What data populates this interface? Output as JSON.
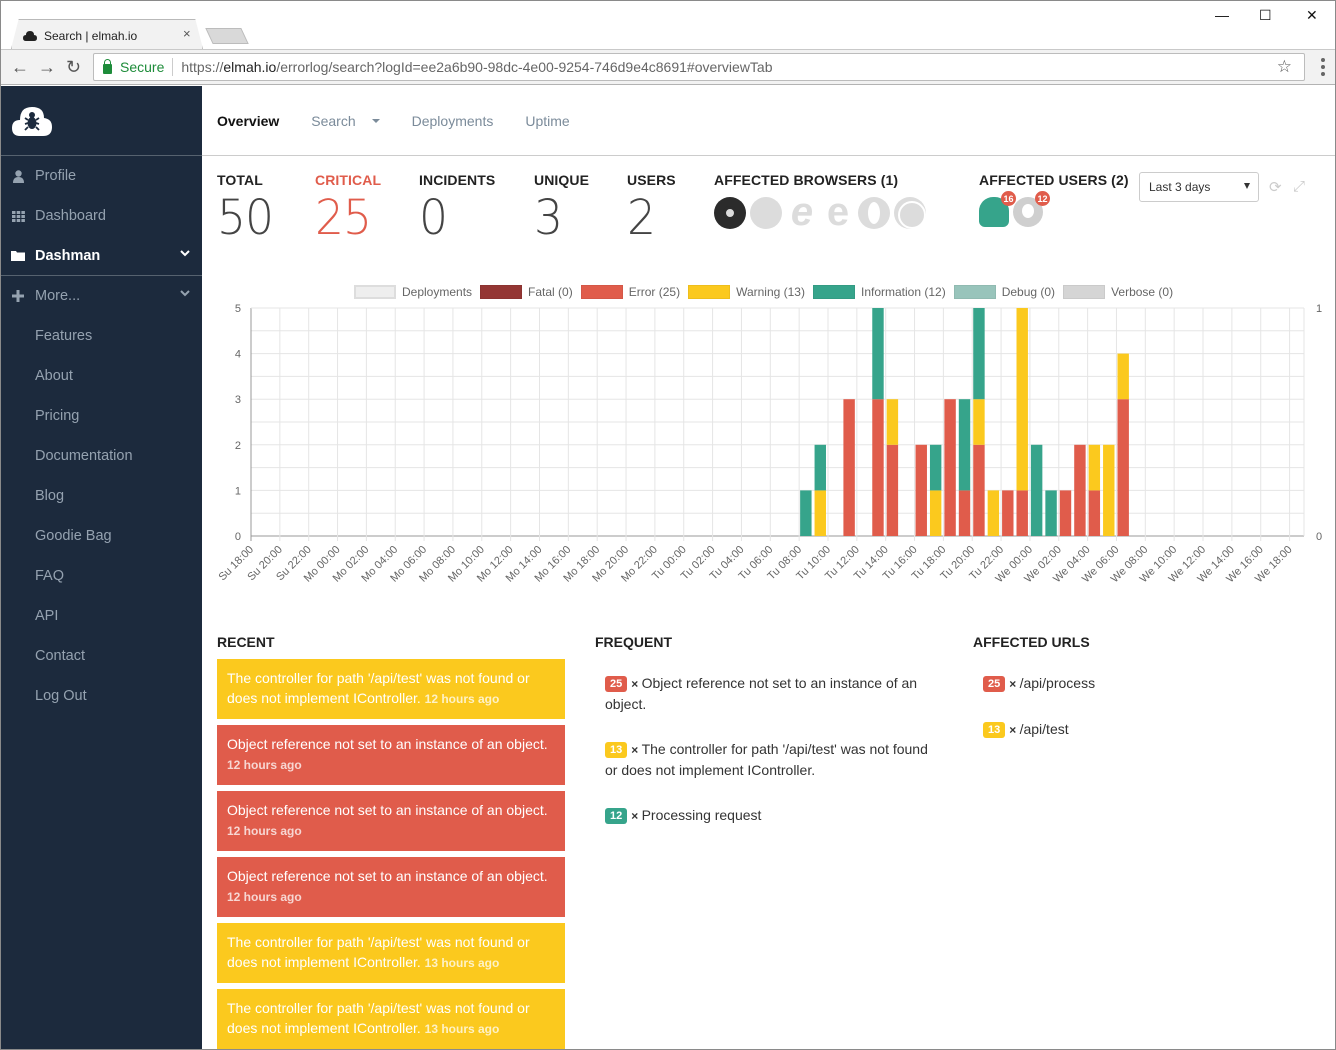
{
  "browser": {
    "tab_title": "Search | elmah.io",
    "tab_close": "×",
    "secure_label": "Secure",
    "url_scheme": "https://",
    "url_host": "elmah.io",
    "url_path": "/errorlog/search?logId=ee2a6b90-98dc-4e00-9254-746d9e4c8691#overviewTab",
    "window_controls": {
      "minimize": "—",
      "maximize": "☐",
      "close": "✕"
    },
    "nav": {
      "back": "←",
      "forward": "→",
      "reload": "↻",
      "star": "☆"
    }
  },
  "sidebar": {
    "items": [
      {
        "label": "Profile",
        "icon": "user-icon",
        "glyph": "👤"
      },
      {
        "label": "Dashboard",
        "icon": "grid-icon",
        "glyph": "▦"
      },
      {
        "label": "Dashman",
        "icon": "folder-icon",
        "glyph": "▬",
        "active": true
      },
      {
        "label": "More...",
        "icon": "plus-icon",
        "glyph": "+"
      },
      {
        "label": "Features"
      },
      {
        "label": "About"
      },
      {
        "label": "Pricing"
      },
      {
        "label": "Documentation"
      },
      {
        "label": "Blog"
      },
      {
        "label": "Goodie Bag"
      },
      {
        "label": "FAQ"
      },
      {
        "label": "API"
      },
      {
        "label": "Contact"
      },
      {
        "label": "Log Out"
      }
    ]
  },
  "topnav": {
    "tabs": [
      {
        "label": "Overview",
        "active": true
      },
      {
        "label": "Search"
      },
      {
        "label": "Deployments"
      },
      {
        "label": "Uptime"
      }
    ]
  },
  "stats": {
    "total": {
      "label": "TOTAL",
      "value": "50"
    },
    "critical": {
      "label": "CRITICAL",
      "value": "25"
    },
    "incidents": {
      "label": "INCIDENTS",
      "value": "0"
    },
    "unique": {
      "label": "UNIQUE",
      "value": "3"
    },
    "users": {
      "label": "USERS",
      "value": "2"
    },
    "affected_browsers": {
      "label": "AFFECTED BROWSERS (1)",
      "browsers": [
        "chrome",
        "firefox",
        "internet-explorer",
        "edge",
        "opera",
        "safari"
      ],
      "active": "chrome"
    },
    "affected_users": {
      "label": "AFFECTED USERS (2)",
      "users": [
        {
          "avatar": "elmah-bug",
          "count": "16"
        },
        {
          "avatar": "generic-user",
          "count": "12"
        }
      ]
    },
    "range_select": "Last 3 days",
    "refresh_icon": "⟳",
    "expand_icon": "⤢"
  },
  "colors": {
    "fatal": "#943634",
    "error": "#e05c4b",
    "warning": "#fbc91e",
    "information": "#36a48b",
    "debug": "#98c4bb",
    "verbose": "#d5d5d5",
    "deployments": "#eeeeee",
    "sidebar_bg": "#1c2a3d"
  },
  "chart_data": {
    "type": "bar",
    "stacked": true,
    "title": "",
    "xlabel": "",
    "ylabel": "",
    "ylim": [
      0,
      5
    ],
    "y2lim": [
      0,
      1
    ],
    "y_ticks": [
      "0",
      "1",
      "2",
      "3",
      "4",
      "5"
    ],
    "y2_ticks": [
      "0",
      "1"
    ],
    "grid": true,
    "legend_position": "top",
    "legend": [
      {
        "key": "deployments",
        "label": "Deployments"
      },
      {
        "key": "fatal",
        "label": "Fatal (0)"
      },
      {
        "key": "error",
        "label": "Error (25)"
      },
      {
        "key": "warning",
        "label": "Warning (13)"
      },
      {
        "key": "information",
        "label": "Information (12)"
      },
      {
        "key": "debug",
        "label": "Debug (0)"
      },
      {
        "key": "verbose",
        "label": "Verbose (0)"
      }
    ],
    "x_tick_labels": [
      "Su 18:00",
      "Su 20:00",
      "Su 22:00",
      "Mo 00:00",
      "Mo 02:00",
      "Mo 04:00",
      "Mo 06:00",
      "Mo 08:00",
      "Mo 10:00",
      "Mo 12:00",
      "Mo 14:00",
      "Mo 16:00",
      "Mo 18:00",
      "Mo 20:00",
      "Mo 22:00",
      "Tu 00:00",
      "Tu 02:00",
      "Tu 04:00",
      "Tu 06:00",
      "Tu 08:00",
      "Tu 10:00",
      "Tu 12:00",
      "Tu 14:00",
      "Tu 16:00",
      "Tu 18:00",
      "Tu 20:00",
      "Tu 22:00",
      "We 00:00",
      "We 02:00",
      "We 04:00",
      "We 06:00",
      "We 08:00",
      "We 10:00",
      "We 12:00",
      "We 14:00",
      "We 16:00",
      "We 18:00"
    ],
    "x_unit": "hour",
    "x_start": "Su 18:00",
    "hours_span": 73,
    "series": [
      {
        "name": "Error",
        "key": "error",
        "points": [
          {
            "x": "Tu 11:00",
            "y": 3
          },
          {
            "x": "Tu 13:00",
            "y": 3
          },
          {
            "x": "Tu 14:00",
            "y": 2
          },
          {
            "x": "Tu 16:00",
            "y": 2
          },
          {
            "x": "Tu 18:00",
            "y": 3
          },
          {
            "x": "Tu 19:00",
            "y": 1
          },
          {
            "x": "Tu 20:00",
            "y": 2
          },
          {
            "x": "Tu 22:00",
            "y": 1
          },
          {
            "x": "Tu 23:00",
            "y": 1
          },
          {
            "x": "We 02:00",
            "y": 1
          },
          {
            "x": "We 03:00",
            "y": 2
          },
          {
            "x": "We 04:00",
            "y": 1
          },
          {
            "x": "We 06:00",
            "y": 3
          }
        ]
      },
      {
        "name": "Warning",
        "key": "warning",
        "points": [
          {
            "x": "Tu 09:00",
            "y": 1
          },
          {
            "x": "Tu 14:00",
            "y": 1
          },
          {
            "x": "Tu 17:00",
            "y": 1
          },
          {
            "x": "Tu 20:00",
            "y": 1
          },
          {
            "x": "Tu 21:00",
            "y": 1
          },
          {
            "x": "Tu 23:00",
            "y": 4
          },
          {
            "x": "We 04:00",
            "y": 1
          },
          {
            "x": "We 05:00",
            "y": 2
          },
          {
            "x": "We 06:00",
            "y": 1
          }
        ]
      },
      {
        "name": "Information",
        "key": "information",
        "points": [
          {
            "x": "Tu 08:00",
            "y": 1
          },
          {
            "x": "Tu 09:00",
            "y": 1
          },
          {
            "x": "Tu 13:00",
            "y": 2
          },
          {
            "x": "Tu 17:00",
            "y": 1
          },
          {
            "x": "Tu 19:00",
            "y": 2
          },
          {
            "x": "Tu 20:00",
            "y": 2
          },
          {
            "x": "We 00:00",
            "y": 2
          },
          {
            "x": "We 01:00",
            "y": 1
          }
        ]
      },
      {
        "name": "Fatal",
        "key": "fatal",
        "points": []
      },
      {
        "name": "Debug",
        "key": "debug",
        "points": []
      },
      {
        "name": "Verbose",
        "key": "verbose",
        "points": []
      }
    ]
  },
  "recent": {
    "title": "RECENT",
    "items": [
      {
        "severity": "warning",
        "message": "The controller for path '/api/test' was not found or does not implement IController.",
        "ago": "12 hours ago"
      },
      {
        "severity": "error",
        "message": "Object reference not set to an instance of an object.",
        "ago": "12 hours ago"
      },
      {
        "severity": "error",
        "message": "Object reference not set to an instance of an object.",
        "ago": "12 hours ago"
      },
      {
        "severity": "error",
        "message": "Object reference not set to an instance of an object.",
        "ago": "12 hours ago"
      },
      {
        "severity": "warning",
        "message": "The controller for path '/api/test' was not found or does not implement IController.",
        "ago": "13 hours ago"
      },
      {
        "severity": "warning",
        "message": "The controller for path '/api/test' was not found or does not implement IController.",
        "ago": "13 hours ago"
      }
    ]
  },
  "frequent": {
    "title": "FREQUENT",
    "items": [
      {
        "count": "25",
        "severity": "error",
        "message": "Object reference not set to an instance of an object."
      },
      {
        "count": "13",
        "severity": "warning",
        "message": "The controller for path '/api/test' was not found or does not implement IController."
      },
      {
        "count": "12",
        "severity": "information",
        "message": "Processing request"
      }
    ]
  },
  "affected_urls": {
    "title": "AFFECTED URLS",
    "items": [
      {
        "count": "25",
        "severity": "error",
        "url": "/api/process"
      },
      {
        "count": "13",
        "severity": "warning",
        "url": "/api/test"
      }
    ]
  },
  "times_symbol": "×"
}
